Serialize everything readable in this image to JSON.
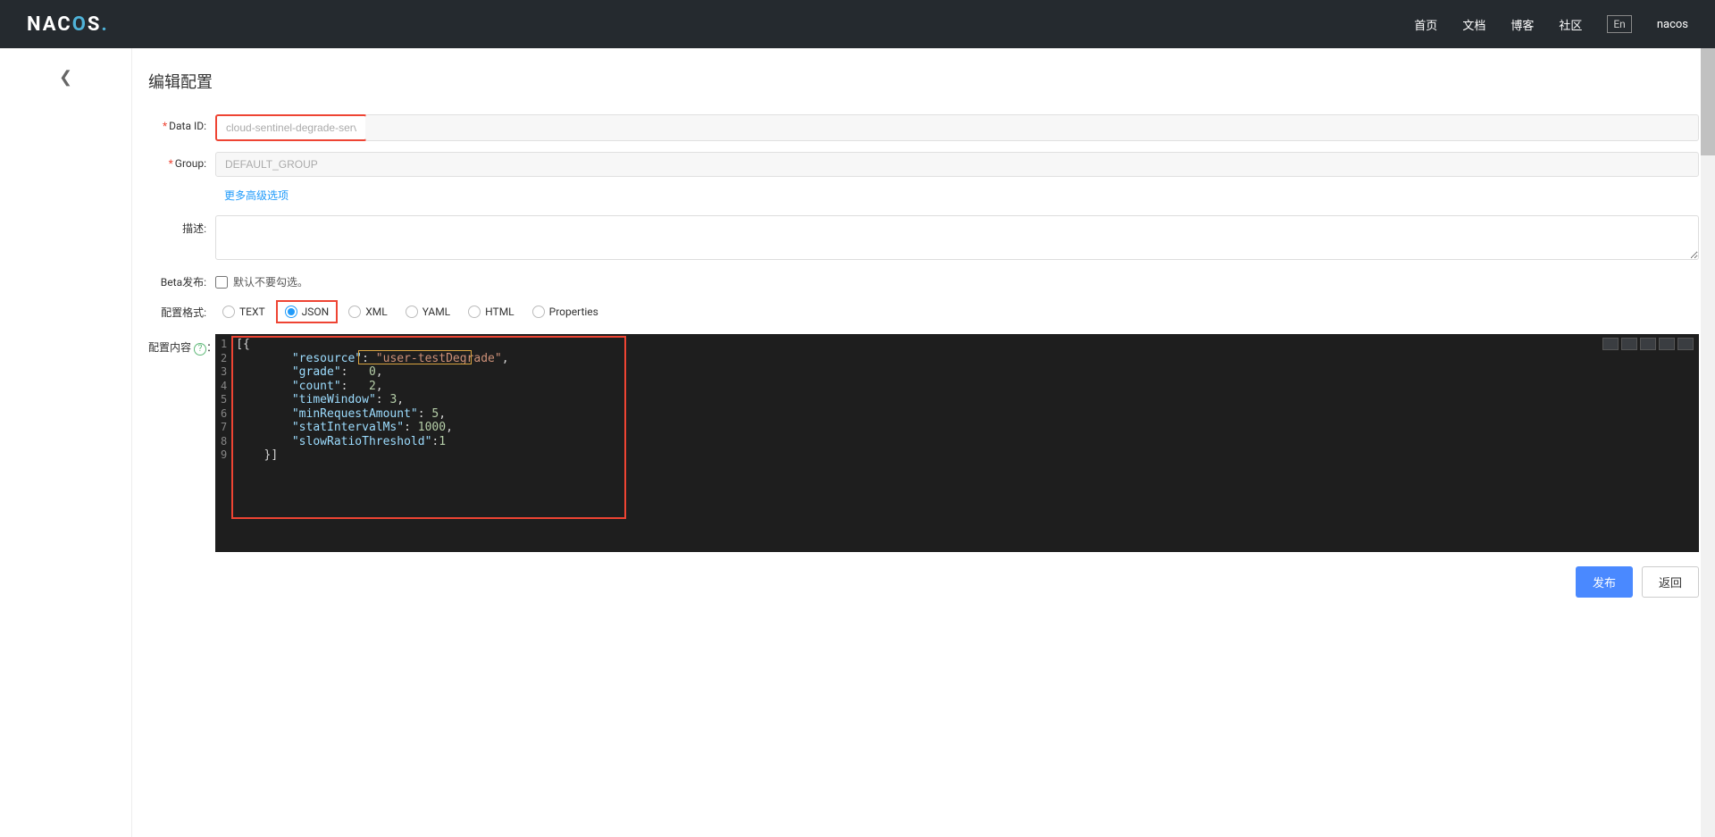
{
  "header": {
    "logo": "NACOS.",
    "nav": {
      "home": "首页",
      "docs": "文档",
      "blog": "博客",
      "community": "社区",
      "lang": "En",
      "user": "nacos"
    }
  },
  "page": {
    "title": "编辑配置",
    "labels": {
      "dataId": "Data ID:",
      "group": "Group:",
      "moreOpts": "更多高级选项",
      "desc": "描述:",
      "beta": "Beta发布:",
      "betaHint": "默认不要勾选。",
      "format": "配置格式:",
      "content": "配置内容",
      "contentColon": "："
    },
    "fields": {
      "dataId": "cloud-sentinel-degrade-service",
      "group": "DEFAULT_GROUP"
    },
    "formats": {
      "text": "TEXT",
      "json": "JSON",
      "xml": "XML",
      "yaml": "YAML",
      "html": "HTML",
      "properties": "Properties"
    },
    "editor": {
      "lineNumbers": [
        "1",
        "2",
        "3",
        "4",
        "5",
        "6",
        "7",
        "8",
        "9"
      ],
      "code": {
        "l1_open": "[{",
        "l2_key": "\"resource\"",
        "l2_colon": ": ",
        "l2_val": "\"user-testDegrade\"",
        "l2_comma": ",",
        "l3_key": "\"grade\"",
        "l3_colon": ":   ",
        "l3_val": "0",
        "l3_comma": ",",
        "l4_key": "\"count\"",
        "l4_colon": ":   ",
        "l4_val": "2",
        "l4_comma": ",",
        "l5_key": "\"timeWindow\"",
        "l5_colon": ": ",
        "l5_val": "3",
        "l5_comma": ",",
        "l6_key": "\"minRequestAmount\"",
        "l6_colon": ": ",
        "l6_val": "5",
        "l6_comma": ",",
        "l7_key": "\"statIntervalMs\"",
        "l7_colon": ": ",
        "l7_val": "1000",
        "l7_comma": ",",
        "l8_key": "\"slowRatioThreshold\"",
        "l8_colon": ":",
        "l8_val": "1",
        "l9_close": "}]"
      }
    },
    "buttons": {
      "publish": "发布",
      "back": "返回"
    }
  }
}
